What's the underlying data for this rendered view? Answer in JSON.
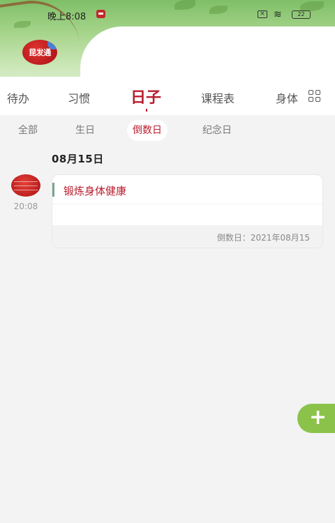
{
  "status_bar": {
    "time": "晚上8:08",
    "battery": "22"
  },
  "profile": {
    "avatar_text": "昆发通"
  },
  "tabs": [
    {
      "label": "待办",
      "active": false
    },
    {
      "label": "习惯",
      "active": false
    },
    {
      "label": "日子",
      "active": true
    },
    {
      "label": "课程表",
      "active": false
    },
    {
      "label": "身体",
      "active": false
    }
  ],
  "filters": [
    {
      "label": "全部",
      "active": false
    },
    {
      "label": "生日",
      "active": false
    },
    {
      "label": "倒数日",
      "active": true
    },
    {
      "label": "纪念日",
      "active": false
    }
  ],
  "group": {
    "date": "08月15日"
  },
  "event": {
    "time": "20:08",
    "title": "锻炼身体健康",
    "footer": "倒数日：2021年08月15"
  },
  "fab": {
    "icon": "plus-icon"
  },
  "colors": {
    "accent": "#b81c2c",
    "fab": "#8bc34a"
  }
}
